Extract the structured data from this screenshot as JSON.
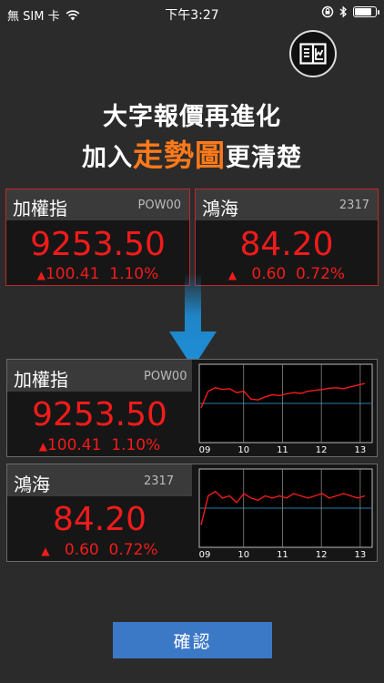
{
  "status_bar": {
    "carrier": "無 SIM 卡",
    "time": "下午3:27",
    "battery_level": 0.85
  },
  "corner_icon": "book-chart-icon",
  "headline": {
    "line1": "大字報價再進化",
    "line2_prefix": "加入",
    "line2_highlight": "走勢圖",
    "line2_suffix": "更清楚",
    "highlight_color": "#ff7a1a"
  },
  "quotes": [
    {
      "name": "加權指",
      "code": "POW00",
      "price": "9253.50",
      "change": "100.41",
      "percent": "1.10%"
    },
    {
      "name": "鴻海",
      "code": "2317",
      "price": "84.20",
      "change": "0.60",
      "percent": "0.72%"
    }
  ],
  "colors": {
    "up": "#f21b1b",
    "accent": "#3b78c6",
    "arrow": "#1e8fd8"
  },
  "chart_data": [
    {
      "type": "line",
      "x_ticks": [
        "09",
        "10",
        "11",
        "12",
        "13"
      ],
      "series": [
        {
          "values": [
            9180,
            9218,
            9226,
            9222,
            9224,
            9215,
            9218,
            9200,
            9198,
            9205,
            9210,
            9208,
            9212,
            9215,
            9213,
            9218,
            9220,
            9222,
            9225,
            9226,
            9224,
            9228,
            9232,
            9236
          ]
        }
      ],
      "ylim": [
        9100,
        9280
      ]
    },
    {
      "type": "line",
      "x_ticks": [
        "09",
        "10",
        "11",
        "12",
        "13"
      ],
      "series": [
        {
          "values": [
            83.0,
            84.3,
            84.5,
            84.2,
            84.3,
            84.0,
            84.4,
            84.2,
            84.1,
            84.3,
            84.2,
            84.3,
            84.2,
            84.4,
            84.3,
            84.2,
            84.3,
            84.4,
            84.2,
            84.3,
            84.4,
            84.3,
            84.2,
            84.3
          ]
        }
      ],
      "ylim": [
        82.0,
        85.5
      ]
    }
  ],
  "confirm_label": "確認"
}
